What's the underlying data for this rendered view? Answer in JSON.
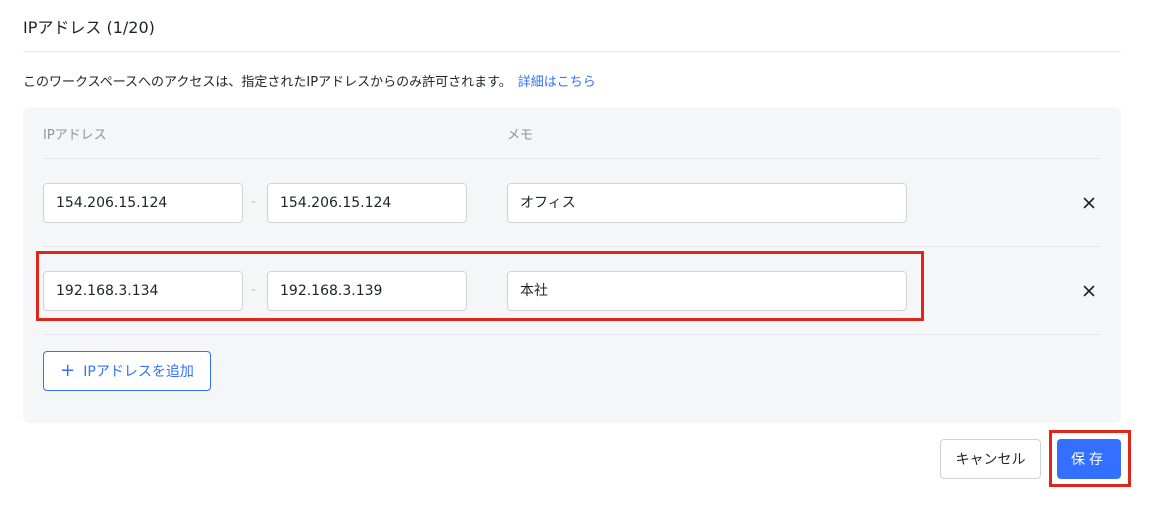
{
  "header": {
    "title": "IPアドレス (1/20)"
  },
  "description": {
    "text": "このワークスペースへのアクセスは、指定されたIPアドレスからのみ許可されます。",
    "link_label": "詳細はこちら"
  },
  "table": {
    "col_ip": "IPアドレス",
    "col_memo": "メモ",
    "separator": "-",
    "rows": [
      {
        "ip_start": "154.206.15.124",
        "ip_end": "154.206.15.124",
        "memo": "オフィス"
      },
      {
        "ip_start": "192.168.3.134",
        "ip_end": "192.168.3.139",
        "memo": "本社"
      }
    ]
  },
  "add_button": {
    "icon": "plus-icon",
    "label": "IPアドレスを追加"
  },
  "footer": {
    "cancel_label": "キャンセル",
    "save_label": "保存"
  },
  "icons": {
    "delete": "close-icon"
  },
  "colors": {
    "accent": "#3370ff",
    "highlight": "#e0261b",
    "panel_bg": "#f5f6f7"
  }
}
